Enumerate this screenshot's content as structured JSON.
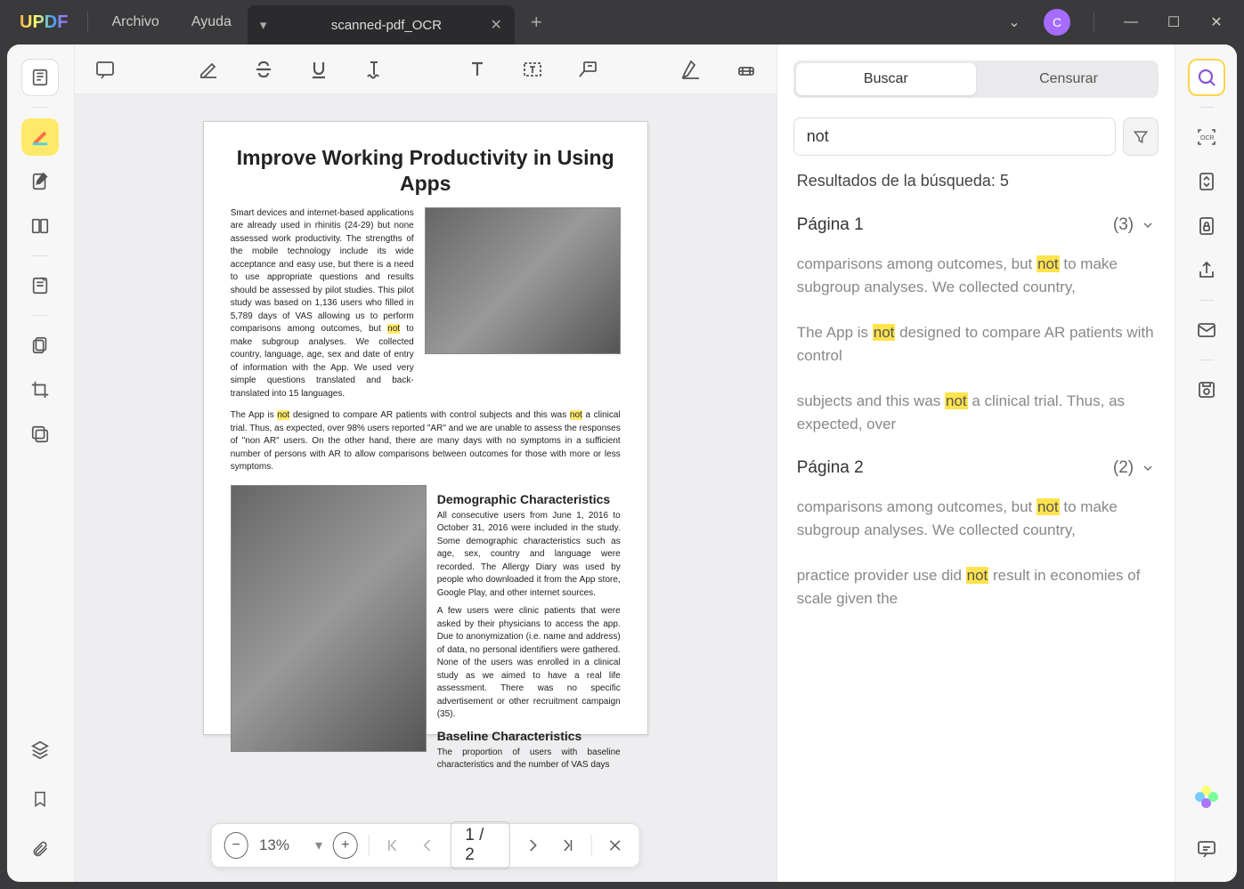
{
  "menu": {
    "archivo": "Archivo",
    "ayuda": "Ayuda"
  },
  "tab": {
    "title": "scanned-pdf_OCR"
  },
  "avatar": "C",
  "document": {
    "title": "Improve Working Productivity in Using Apps",
    "para1a": "Smart devices and internet-based applications are already used in rhinitis (24-29) but none assessed work productivity. The strengths of the mobile technology include its wide acceptance and easy use, but there is a need to use appropriate questions and results should be assessed by pilot studies. This pilot study was based on 1,136 users who filled in 5,789 days of VAS allowing us to perform comparisons among outcomes, but ",
    "hl1": "not",
    "para1b": " to make subgroup analyses. We collected country, language, age, sex and date of entry of information with the App. We used very simple questions translated and back-translated into 15 languages.",
    "para2a": "The App is ",
    "hl2": "not",
    "para2b": " designed to compare AR patients with control subjects and this was ",
    "hl3": "not",
    "para2c": " a clinical trial. Thus, as expected, over 98% users reported \"AR\" and we are unable to assess the responses of \"non AR\" users. On the other hand, there are many days with no symptoms in a sufficient number of persons with AR to allow comparisons between outcomes for those with more or less symptoms.",
    "h2a": "Demographic Characteristics",
    "para3": "All consecutive users from June 1, 2016 to October 31, 2016 were included in the study. Some demographic characteristics such as age, sex, country and language were recorded. The Allergy Diary was used by people who downloaded it from the App store, Google Play, and other internet sources.",
    "para4": "A few users were clinic patients that were asked by their physicians to access the app. Due to anonymization (i.e. name and address) of data, no personal identifiers were gathered. None of the users was enrolled in a clinical study as we aimed to have a real life assessment. There was no specific advertisement or other    recruitment campaign (35).",
    "h2b": "Baseline Characteristics",
    "para5": "The proportion of users with baseline characteristics and the number of VAS days"
  },
  "zoom": "13%",
  "page_indicator": "1  /  2",
  "search": {
    "tab_buscar": "Buscar",
    "tab_censurar": "Censurar",
    "query": "not",
    "results_label": "Resultados de la búsqueda: 5",
    "pages": [
      {
        "title": "Página 1",
        "count": "(3)"
      },
      {
        "title": "Página 2",
        "count": "(2)"
      }
    ],
    "r1a": "comparisons among outcomes, but ",
    "r1h": "not",
    "r1b": " to make subgroup analyses. We collected country,",
    "r2a": "The App is ",
    "r2h": "not",
    "r2b": " designed to compare AR patients with control",
    "r3a": "subjects and this was ",
    "r3h": "not",
    "r3b": " a clinical trial. Thus, as expected, over",
    "r4a": "comparisons among outcomes, but ",
    "r4h": "not",
    "r4b": " to make subgroup analyses. We collected country,",
    "r5a": "practice provider use did ",
    "r5h": "not",
    "r5b": " result in economies of scale given the"
  }
}
